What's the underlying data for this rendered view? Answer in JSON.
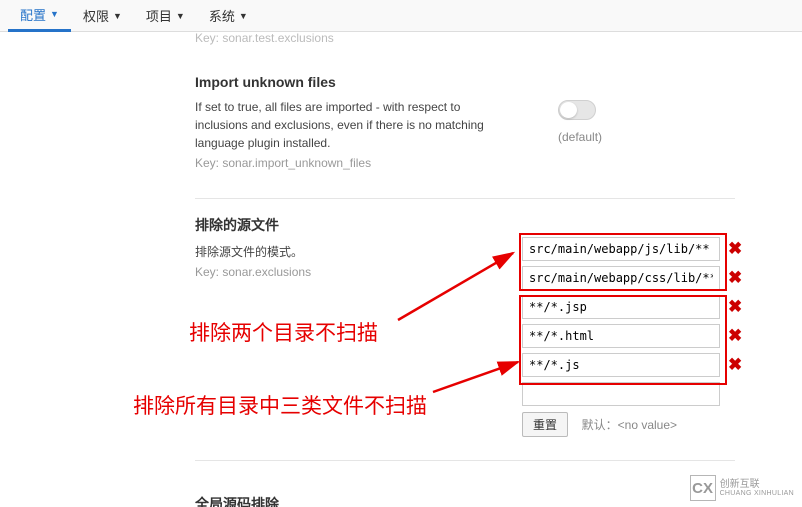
{
  "nav": {
    "tabs": [
      {
        "label": "配置",
        "active": true
      },
      {
        "label": "权限",
        "active": false
      },
      {
        "label": "项目",
        "active": false
      },
      {
        "label": "系统",
        "active": false
      }
    ]
  },
  "cut_key_top": "Key: sonar.test.exclusions",
  "import_section": {
    "title": "Import unknown files",
    "desc": "If set to true, all files are imported - with respect to inclusions and exclusions, even if there is no matching language plugin installed.",
    "key": "Key: sonar.import_unknown_files",
    "default_label": "(default)"
  },
  "exclusion_section": {
    "title": "排除的源文件",
    "desc": "排除源文件的模式。",
    "key": "Key: sonar.exclusions",
    "inputs": [
      "src/main/webapp/js/lib/**",
      "src/main/webapp/css/lib/**",
      "**/*.jsp",
      "**/*.html",
      "**/*.js",
      ""
    ],
    "reset_label": "重置",
    "default_note": "默认：<no value>"
  },
  "annotations": {
    "anno1": "排除两个目录不扫描",
    "anno2": "排除所有目录中三类文件不扫描"
  },
  "bottom_title": "全局源码排除",
  "watermark": {
    "logo_letters": "CX",
    "line1": "创新互联",
    "line2": "CHUANG XINHULIAN"
  }
}
